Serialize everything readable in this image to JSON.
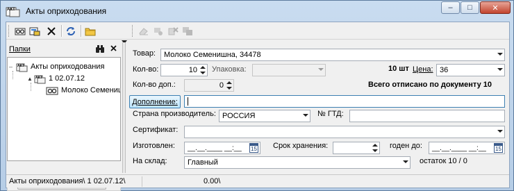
{
  "window": {
    "title": "Акты оприходования",
    "icon_label": "АКТ",
    "controls": {
      "minimize": "–",
      "maximize": "□",
      "close": "✕"
    }
  },
  "toolbar": {
    "buttons": [
      {
        "name": "open",
        "icon": "eye-glasses-icon"
      },
      {
        "name": "edit",
        "icon": "edit-card-icon"
      },
      {
        "name": "delete",
        "icon": "close-icon"
      },
      {
        "name": "refresh",
        "icon": "refresh-icon"
      },
      {
        "name": "folder",
        "icon": "folder-icon"
      }
    ],
    "disabled_buttons": [
      {
        "name": "eraser",
        "icon": "eraser-icon"
      },
      {
        "name": "stamp",
        "icon": "stamp-icon"
      },
      {
        "name": "delete-2",
        "icon": "delete-card-icon"
      },
      {
        "name": "copy",
        "icon": "copy-icon"
      }
    ]
  },
  "folders": {
    "title": "Папки",
    "tree": [
      {
        "label": "Акты оприходования",
        "icon_label": "АКТ",
        "expander": "–"
      },
      {
        "label": "1 02.07.12",
        "icon_label": "АКТ",
        "expander": "▲"
      },
      {
        "label": "Молоко Семенишна",
        "icon_label": ""
      }
    ]
  },
  "form": {
    "product": {
      "label": "Товар:",
      "value": "Молоко Семенишна, 34478"
    },
    "qty": {
      "label": "Кол-во:",
      "value": "10"
    },
    "pack": {
      "label": "Упаковка:",
      "value": ""
    },
    "qty_summary": "10 шт",
    "price": {
      "label": "Цена:",
      "value": "36"
    },
    "qty_extra": {
      "label": "Кол-во доп.:",
      "value": "0"
    },
    "total_note": "Всего отписано по документу 10",
    "addition": {
      "button": "Дополнение:",
      "value": ""
    },
    "country": {
      "label": "Страна производитель:",
      "value": "РОССИЯ"
    },
    "gtd": {
      "label": "№ ГТД:",
      "value": ""
    },
    "certificate": {
      "label": "Сертификат:",
      "value": ""
    },
    "made": {
      "label": "Изготовлен:",
      "value": "__.__.____ __:__"
    },
    "shelf_life": {
      "label": "Срок хранения:",
      "value": ""
    },
    "valid_to": {
      "label": "годен до:",
      "value": "__.__.____ __:__"
    },
    "warehouse": {
      "label": "На склад:",
      "value": "Главный"
    },
    "stock": "остаток 10 / 0",
    "calendar_label": "15"
  },
  "status": {
    "path": "Акты оприходования\\ 1 02.07.12\\",
    "amount": "0.00\\"
  }
}
